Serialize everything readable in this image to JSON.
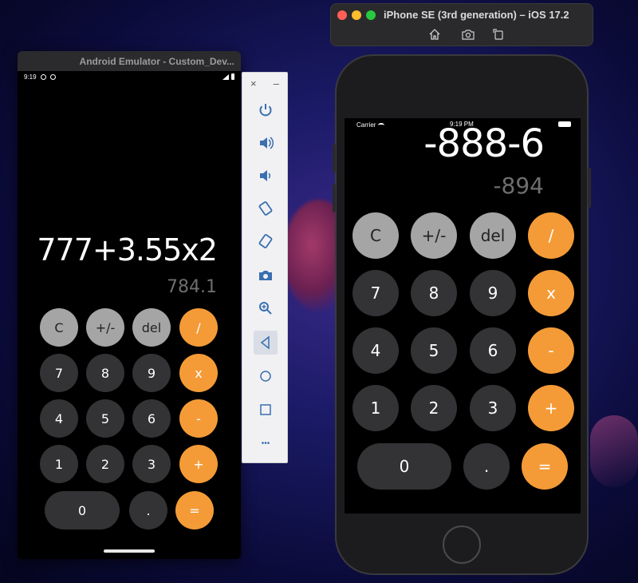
{
  "android": {
    "window_title": "Android Emulator - Custom_Dev...",
    "status_time": "9:19",
    "expression": "777+3.55x2",
    "result": "784.1"
  },
  "ios": {
    "window_title": "iPhone SE (3rd generation) – iOS 17.2",
    "carrier": "Carrier",
    "status_time": "9:19 PM",
    "expression": "-888-6",
    "result": "-894"
  },
  "keypad": {
    "clear": "C",
    "sign": "+/-",
    "delete": "del",
    "divide": "/",
    "multiply": "x",
    "minus": "-",
    "plus": "+",
    "equals": "=",
    "dot": ".",
    "digits": [
      "0",
      "1",
      "2",
      "3",
      "4",
      "5",
      "6",
      "7",
      "8",
      "9"
    ]
  },
  "emulator_toolbar": {
    "close": "×",
    "minimize": "–",
    "more": "•••",
    "icons": [
      "power-icon",
      "volume-up-icon",
      "volume-down-icon",
      "rotate-left-icon",
      "rotate-right-icon",
      "camera-icon",
      "zoom-icon",
      "back-icon",
      "home-icon",
      "overview-icon",
      "more-icon"
    ]
  },
  "colors": {
    "operator": "#f49b37",
    "function": "#a5a5a5",
    "digit": "#333335"
  }
}
